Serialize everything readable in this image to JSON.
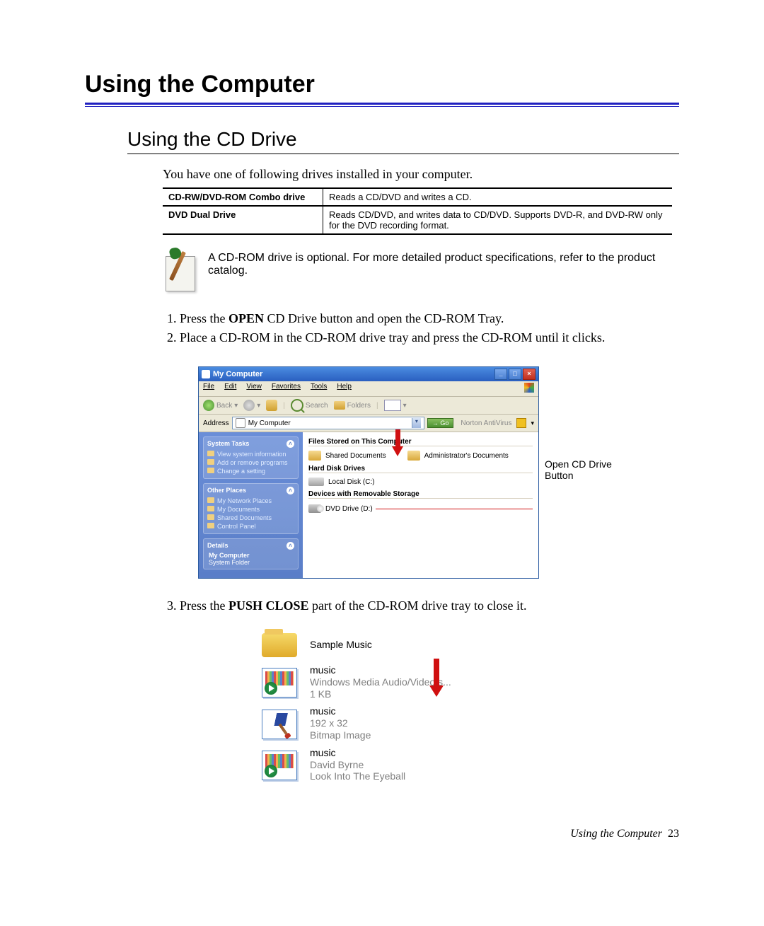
{
  "title": "Using the Computer",
  "section": "Using the CD Drive",
  "intro": "You have one of following drives installed in your computer.",
  "drive_table": [
    {
      "name": "CD-RW/DVD-ROM Combo drive",
      "desc": "Reads a CD/DVD and writes a CD."
    },
    {
      "name": "DVD Dual Drive",
      "desc": "Reads CD/DVD, and writes data to CD/DVD. Supports DVD-R, and DVD-RW only for the DVD recording format."
    }
  ],
  "note": "A CD-ROM drive is optional. For more detailed product specifications, refer to the product catalog.",
  "steps": {
    "s1_pre": "Press the ",
    "s1_bold": "OPEN",
    "s1_post": " CD Drive button and open the CD-ROM Tray.",
    "s2": "Place a CD-ROM in the CD-ROM drive tray and press the CD-ROM until it clicks.",
    "s3_pre": "Press the ",
    "s3_bold": "PUSH CLOSE",
    "s3_post": " part of the CD-ROM drive tray to close it."
  },
  "win": {
    "title": "My Computer",
    "menu": {
      "file": "File",
      "edit": "Edit",
      "view": "View",
      "favorites": "Favorites",
      "tools": "Tools",
      "help": "Help"
    },
    "toolbar": {
      "back": "Back",
      "search": "Search",
      "folders": "Folders"
    },
    "address_label": "Address",
    "address_value": "My Computer",
    "go": "Go",
    "norton": "Norton AntiVirus",
    "side": {
      "tasks_title": "System Tasks",
      "task1": "View system information",
      "task2": "Add or remove programs",
      "task3": "Change a setting",
      "places_title": "Other Places",
      "place1": "My Network Places",
      "place2": "My Documents",
      "place3": "Shared Documents",
      "place4": "Control Panel",
      "details_title": "Details",
      "details_name": "My Computer",
      "details_sub": "System Folder"
    },
    "groups": {
      "g1": "Files Stored on This Computer",
      "g1a": "Shared Documents",
      "g1b": "Administrator's Documents",
      "g2": "Hard Disk Drives",
      "g2a": "Local Disk (C:)",
      "g3": "Devices with Removable Storage",
      "g3a": "DVD Drive (D:)"
    }
  },
  "callout": "Open CD Drive Button",
  "files": {
    "f1_name": "Sample Music",
    "f2_name": "music",
    "f2_sub1": "Windows Media Audio/Video s...",
    "f2_sub2": "1 KB",
    "f3_name": "music",
    "f3_sub1": "192 x 32",
    "f3_sub2": "Bitmap Image",
    "f4_name": "music",
    "f4_sub1": "David Byrne",
    "f4_sub2": "Look Into The Eyeball"
  },
  "footer_label": "Using the Computer",
  "footer_page": "23"
}
